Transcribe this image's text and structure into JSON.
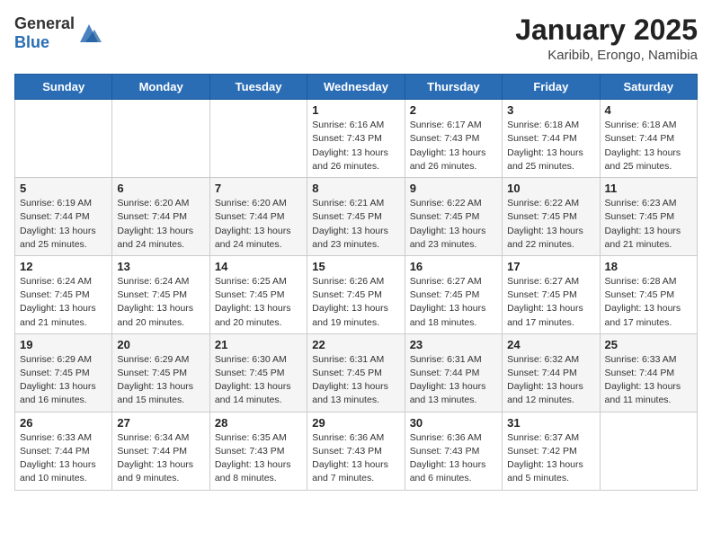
{
  "header": {
    "logo_general": "General",
    "logo_blue": "Blue",
    "month_title": "January 2025",
    "location": "Karibib, Erongo, Namibia"
  },
  "days_of_week": [
    "Sunday",
    "Monday",
    "Tuesday",
    "Wednesday",
    "Thursday",
    "Friday",
    "Saturday"
  ],
  "weeks": [
    [
      {
        "day": "",
        "info": ""
      },
      {
        "day": "",
        "info": ""
      },
      {
        "day": "",
        "info": ""
      },
      {
        "day": "1",
        "info": "Sunrise: 6:16 AM\nSunset: 7:43 PM\nDaylight: 13 hours\nand 26 minutes."
      },
      {
        "day": "2",
        "info": "Sunrise: 6:17 AM\nSunset: 7:43 PM\nDaylight: 13 hours\nand 26 minutes."
      },
      {
        "day": "3",
        "info": "Sunrise: 6:18 AM\nSunset: 7:44 PM\nDaylight: 13 hours\nand 25 minutes."
      },
      {
        "day": "4",
        "info": "Sunrise: 6:18 AM\nSunset: 7:44 PM\nDaylight: 13 hours\nand 25 minutes."
      }
    ],
    [
      {
        "day": "5",
        "info": "Sunrise: 6:19 AM\nSunset: 7:44 PM\nDaylight: 13 hours\nand 25 minutes."
      },
      {
        "day": "6",
        "info": "Sunrise: 6:20 AM\nSunset: 7:44 PM\nDaylight: 13 hours\nand 24 minutes."
      },
      {
        "day": "7",
        "info": "Sunrise: 6:20 AM\nSunset: 7:44 PM\nDaylight: 13 hours\nand 24 minutes."
      },
      {
        "day": "8",
        "info": "Sunrise: 6:21 AM\nSunset: 7:45 PM\nDaylight: 13 hours\nand 23 minutes."
      },
      {
        "day": "9",
        "info": "Sunrise: 6:22 AM\nSunset: 7:45 PM\nDaylight: 13 hours\nand 23 minutes."
      },
      {
        "day": "10",
        "info": "Sunrise: 6:22 AM\nSunset: 7:45 PM\nDaylight: 13 hours\nand 22 minutes."
      },
      {
        "day": "11",
        "info": "Sunrise: 6:23 AM\nSunset: 7:45 PM\nDaylight: 13 hours\nand 21 minutes."
      }
    ],
    [
      {
        "day": "12",
        "info": "Sunrise: 6:24 AM\nSunset: 7:45 PM\nDaylight: 13 hours\nand 21 minutes."
      },
      {
        "day": "13",
        "info": "Sunrise: 6:24 AM\nSunset: 7:45 PM\nDaylight: 13 hours\nand 20 minutes."
      },
      {
        "day": "14",
        "info": "Sunrise: 6:25 AM\nSunset: 7:45 PM\nDaylight: 13 hours\nand 20 minutes."
      },
      {
        "day": "15",
        "info": "Sunrise: 6:26 AM\nSunset: 7:45 PM\nDaylight: 13 hours\nand 19 minutes."
      },
      {
        "day": "16",
        "info": "Sunrise: 6:27 AM\nSunset: 7:45 PM\nDaylight: 13 hours\nand 18 minutes."
      },
      {
        "day": "17",
        "info": "Sunrise: 6:27 AM\nSunset: 7:45 PM\nDaylight: 13 hours\nand 17 minutes."
      },
      {
        "day": "18",
        "info": "Sunrise: 6:28 AM\nSunset: 7:45 PM\nDaylight: 13 hours\nand 17 minutes."
      }
    ],
    [
      {
        "day": "19",
        "info": "Sunrise: 6:29 AM\nSunset: 7:45 PM\nDaylight: 13 hours\nand 16 minutes."
      },
      {
        "day": "20",
        "info": "Sunrise: 6:29 AM\nSunset: 7:45 PM\nDaylight: 13 hours\nand 15 minutes."
      },
      {
        "day": "21",
        "info": "Sunrise: 6:30 AM\nSunset: 7:45 PM\nDaylight: 13 hours\nand 14 minutes."
      },
      {
        "day": "22",
        "info": "Sunrise: 6:31 AM\nSunset: 7:45 PM\nDaylight: 13 hours\nand 13 minutes."
      },
      {
        "day": "23",
        "info": "Sunrise: 6:31 AM\nSunset: 7:44 PM\nDaylight: 13 hours\nand 13 minutes."
      },
      {
        "day": "24",
        "info": "Sunrise: 6:32 AM\nSunset: 7:44 PM\nDaylight: 13 hours\nand 12 minutes."
      },
      {
        "day": "25",
        "info": "Sunrise: 6:33 AM\nSunset: 7:44 PM\nDaylight: 13 hours\nand 11 minutes."
      }
    ],
    [
      {
        "day": "26",
        "info": "Sunrise: 6:33 AM\nSunset: 7:44 PM\nDaylight: 13 hours\nand 10 minutes."
      },
      {
        "day": "27",
        "info": "Sunrise: 6:34 AM\nSunset: 7:44 PM\nDaylight: 13 hours\nand 9 minutes."
      },
      {
        "day": "28",
        "info": "Sunrise: 6:35 AM\nSunset: 7:43 PM\nDaylight: 13 hours\nand 8 minutes."
      },
      {
        "day": "29",
        "info": "Sunrise: 6:36 AM\nSunset: 7:43 PM\nDaylight: 13 hours\nand 7 minutes."
      },
      {
        "day": "30",
        "info": "Sunrise: 6:36 AM\nSunset: 7:43 PM\nDaylight: 13 hours\nand 6 minutes."
      },
      {
        "day": "31",
        "info": "Sunrise: 6:37 AM\nSunset: 7:42 PM\nDaylight: 13 hours\nand 5 minutes."
      },
      {
        "day": "",
        "info": ""
      }
    ]
  ]
}
